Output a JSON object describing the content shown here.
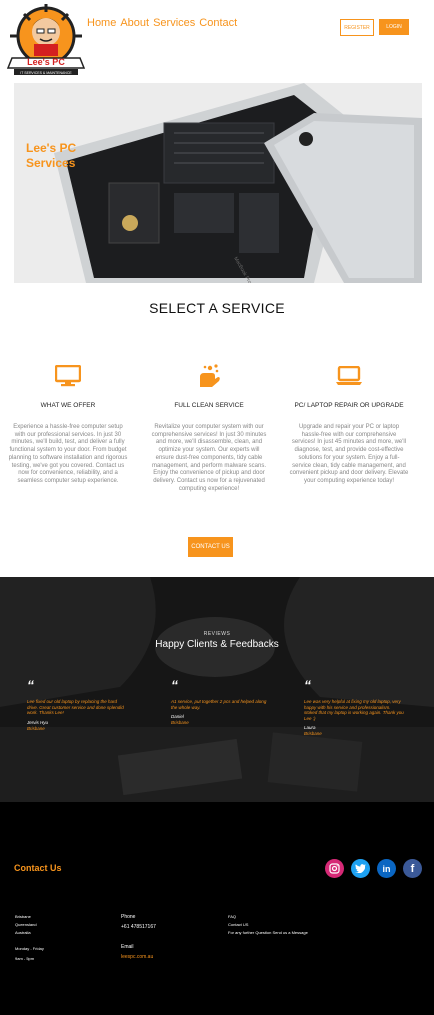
{
  "brand": {
    "name": "Lee's PC",
    "tagline": "IT SERVICES & MAINTENANCE"
  },
  "nav": {
    "items": [
      "Home",
      "About",
      "Services",
      "Contact"
    ]
  },
  "header": {
    "register": "REGISTER",
    "login": "LOGIN"
  },
  "hero": {
    "title": "Lee's PC Services",
    "device_label": "MacBook Pro"
  },
  "services": {
    "title": "SELECT A SERVICE",
    "items": [
      {
        "icon": "monitor-icon",
        "title": "WHAT WE OFFER",
        "desc": "Experience a hassle-free computer setup with our professional services. In just 30 minutes, we'll build, test, and deliver a fully functional system to your door. From budget planning to software installation and rigorous testing, we've got you covered. Contact us now for convenience, reliability, and a seamless computer setup experience."
      },
      {
        "icon": "cleaning-hands-icon",
        "title": "FULL CLEAN SERVICE",
        "desc": "Revitalize your computer system with our comprehensive services! In just 30 minutes and more, we'll disassemble, clean, and optimize your system. Our experts will ensure dust-free components, tidy cable management, and perform malware scans. Enjoy the convenience of pickup and door delivery. Contact us now for a rejuvenated computing experience!"
      },
      {
        "icon": "laptop-icon",
        "title": "PC/ LAPTOP REPAIR OR UPGRADE",
        "desc": "Upgrade and repair your PC or laptop hassle-free with our comprehensive services! In just 45 minutes and more, we'll diagnose, test, and provide cost-effective solutions for your system. Enjoy a full-service clean, tidy cable management, and convenient pickup and door delivery. Elevate your computing experience today!"
      }
    ],
    "contact_button": "CONTACT US"
  },
  "reviews": {
    "label": "REVIEWS",
    "title": "Happy Clients & Feedbacks",
    "items": [
      {
        "text": "Lee fixed our old laptop by replacing the hard drive. Great customer service and done splendid work. Thanks Lee!",
        "name": "Jervis Hyu",
        "city": "Brisbane"
      },
      {
        "text": "A1 service, put together 2 pcs and helped along the whole way.",
        "name": "Daniel",
        "city": "Brisbane"
      },
      {
        "text": "Lee was very helpful at fixing my old laptop, very happy with his service and professionalism. stoked that my laptop is working again. Thank you Lee :)",
        "name": "Laura",
        "city": "Brisbane"
      }
    ]
  },
  "footer": {
    "title": "Contact Us",
    "location": [
      "Brisbane",
      "Queensland",
      "Australia"
    ],
    "hours_label": "Monday - Friday",
    "hours": "9am - 5pm",
    "phone_label": "Phone",
    "phone": "+61 478517167",
    "email_label": "Email",
    "email": "leespc.com.au",
    "faq_label": "FAQ",
    "faq_contact": "Contact US",
    "faq_text": "For any further Question Send us a Message",
    "social": [
      "instagram-icon",
      "twitter-icon",
      "linkedin-icon",
      "facebook-icon"
    ]
  },
  "colors": {
    "accent": "#f7941d",
    "dark": "#1a1a1a",
    "footer": "#000000"
  }
}
